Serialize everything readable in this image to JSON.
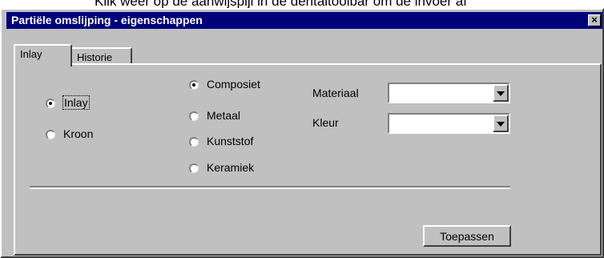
{
  "background_text": "Klik weer op de aanwijspijl in de dentaltoolbar om de invoer af",
  "dialog": {
    "title": "Partiële omslijping - eigenschappen",
    "close_label": "×"
  },
  "tabs": [
    {
      "label": "Inlay",
      "active": true
    },
    {
      "label": "Historie",
      "active": false
    }
  ],
  "type_options": [
    {
      "label": "Inlay",
      "selected": true
    },
    {
      "label": "Kroon",
      "selected": false
    }
  ],
  "material_options": [
    {
      "label": "Composiet",
      "selected": true
    },
    {
      "label": "Metaal",
      "selected": false
    },
    {
      "label": "Kunststof",
      "selected": false
    },
    {
      "label": "Keramiek",
      "selected": false
    }
  ],
  "fields": {
    "materiaal_label": "Materiaal",
    "materiaal_value": "",
    "kleur_label": "Kleur",
    "kleur_value": ""
  },
  "apply_button": "Toepassen"
}
